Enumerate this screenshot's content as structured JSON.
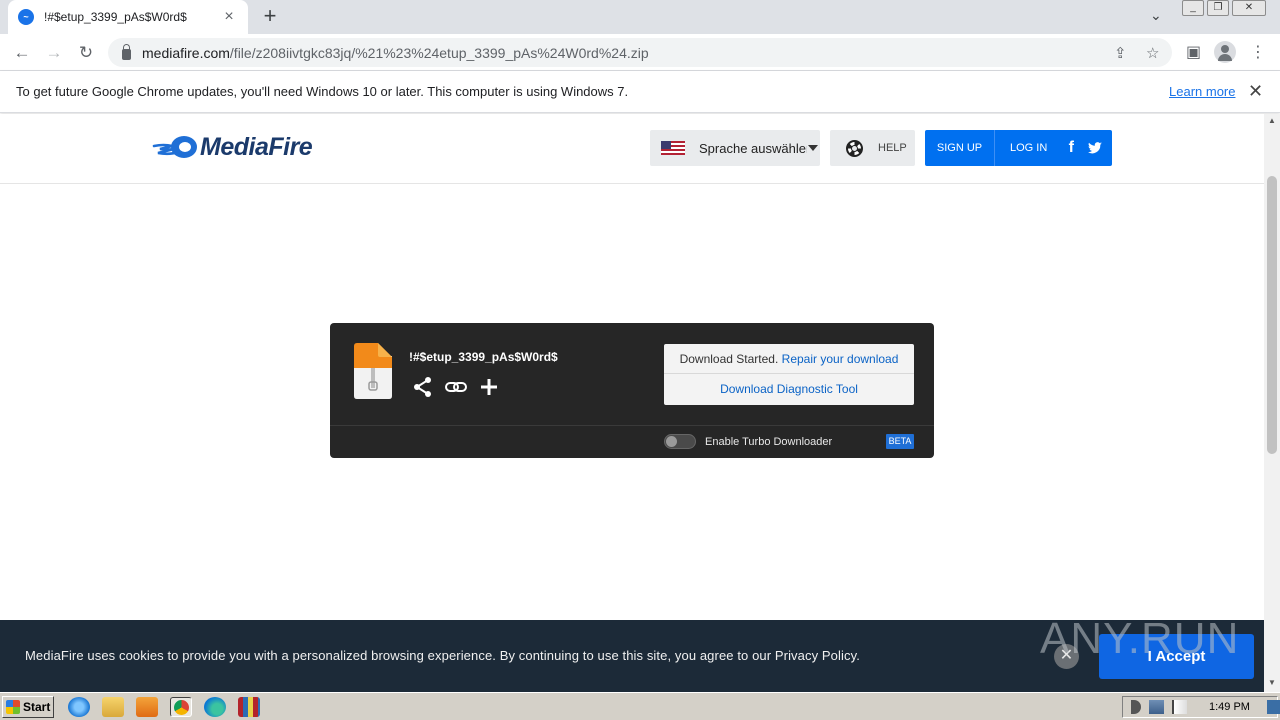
{
  "browser": {
    "tab_title": "!#$etup_3399_pAs$W0rd$",
    "url_domain": "mediafire.com",
    "url_path": "/file/z208iivtgkc83jq/%21%23%24etup_3399_pAs%24W0rd%24.zip"
  },
  "infobar": {
    "message": "To get future Google Chrome updates, you'll need Windows 10 or later. This computer is using Windows 7.",
    "link": "Learn more"
  },
  "header": {
    "logo_text": "MediaFire",
    "language_label": "Sprache auswählen",
    "help_label": "HELP",
    "signup_label": "SIGN UP",
    "login_label": "LOG IN"
  },
  "download": {
    "file_name": "!#$etup_3399_pAs$W0rd$",
    "status_text": "Download Started.",
    "repair_link": "Repair your download",
    "diagnostic_link": "Download Diagnostic Tool",
    "turbo_label": "Enable Turbo Downloader",
    "turbo_enabled": false,
    "beta_badge": "BETA"
  },
  "cookie": {
    "message": "MediaFire uses cookies to provide you with a personalized browsing experience. By continuing to use this site, you agree to our Privacy Policy.",
    "accept_label": "I Accept"
  },
  "watermark": "ANY.RUN",
  "taskbar": {
    "start_label": "Start",
    "clock": "1:49 PM"
  },
  "colors": {
    "mediafire_blue": "#0070f0",
    "logo_navy": "#1b3a6b",
    "card_bg": "#262626",
    "cookie_bg": "#1c2a38",
    "link_blue": "#0b63c6"
  }
}
